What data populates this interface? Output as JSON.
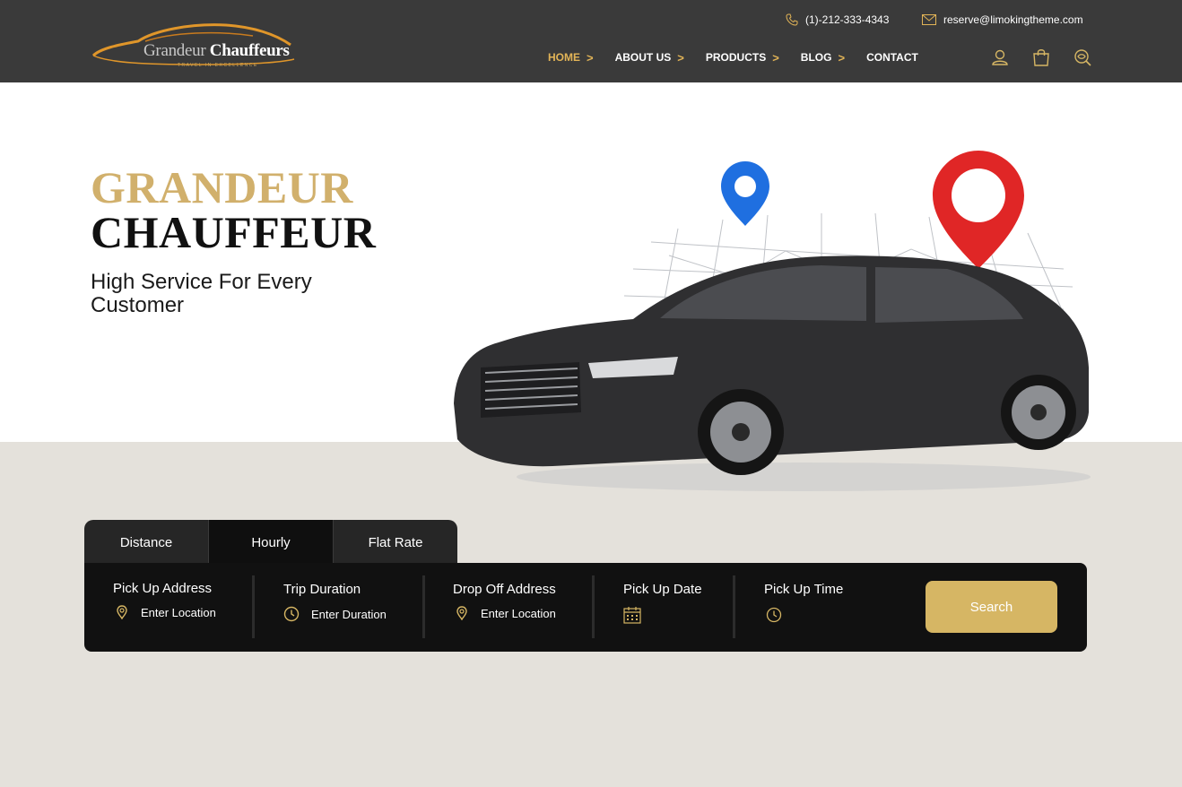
{
  "brand": {
    "name_first": "Grandeur",
    "name_second": "Chauffeurs",
    "tagline": "TRAVEL IN EXCELLENCE"
  },
  "contact": {
    "phone": "(1)-212-333-4343",
    "email": "reserve@limokingtheme.com"
  },
  "nav": {
    "items": [
      {
        "label": "HOME",
        "chevron": ">"
      },
      {
        "label": "ABOUT US",
        "chevron": ">"
      },
      {
        "label": "PRODUCTS",
        "chevron": ">"
      },
      {
        "label": "BLOG",
        "chevron": ">"
      },
      {
        "label": "CONTACT",
        "chevron": ""
      }
    ],
    "active": "HOME",
    "icons": [
      "user-icon",
      "shopping-bag-icon",
      "search-icon"
    ]
  },
  "hero": {
    "title_line1": "GRANDEUR",
    "title_line2": "CHAUFFEUR",
    "subtitle": "High Service For Every Customer"
  },
  "booking": {
    "tabs": [
      "Distance",
      "Hourly",
      "Flat Rate"
    ],
    "active_tab": "Hourly",
    "fields": [
      {
        "label": "Pick Up Address",
        "value": "Enter Location",
        "icon": "location-pin-icon"
      },
      {
        "label": "Trip Duration",
        "value": "Enter Duration",
        "icon": "clock-icon"
      },
      {
        "label": "Drop Off Address",
        "value": "Enter Location",
        "icon": "location-pin-icon"
      },
      {
        "label": "Pick Up Date",
        "value": "",
        "icon": "calendar-icon"
      },
      {
        "label": "Pick Up Time",
        "value": "",
        "icon": "clock-icon"
      }
    ],
    "search_label": "Search"
  },
  "colors": {
    "header_bg": "#3a3a3a",
    "accent_gold": "#d6b664",
    "nav_active": "#e2b457",
    "panel_bg": "#111111",
    "page_bg": "#e4e1db"
  }
}
